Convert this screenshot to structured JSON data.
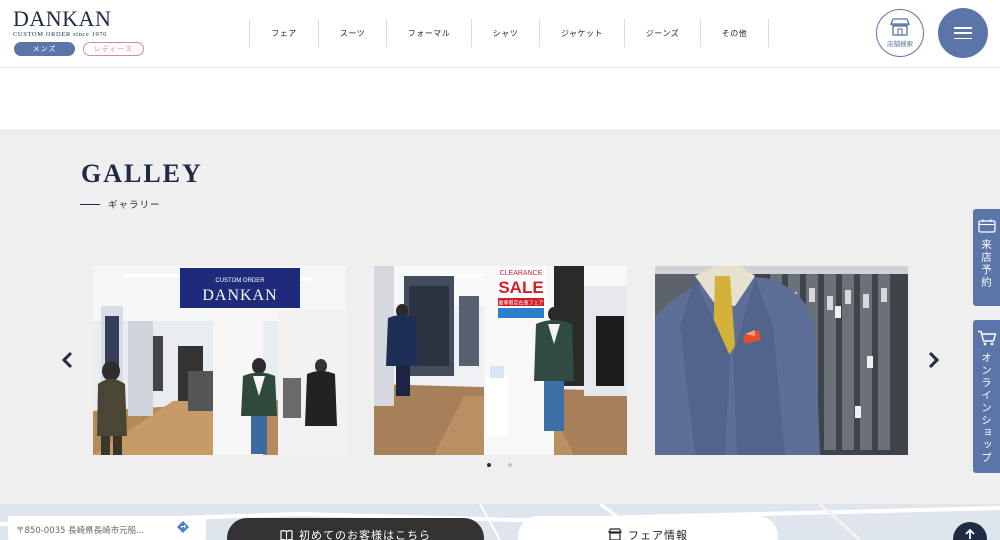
{
  "header": {
    "logo": "DANKAN",
    "logo_sub": "CUSTOM ORDER since 1976",
    "gender_men": "メンズ",
    "gender_women": "レディース",
    "nav": [
      "フェア",
      "スーツ",
      "フォーマル",
      "シャツ",
      "ジャケット",
      "ジーンズ",
      "その他"
    ],
    "store_search": "店舗検索"
  },
  "gallery": {
    "title": "GALLEY",
    "subtitle": "ギャラリー",
    "sign_custom": "CUSTOM ORDER",
    "sign_brand": "DANKAN",
    "sale_top": "CLEARANCE",
    "sale_main": "SALE",
    "sale_bottom": "夏季限定在庫フェア",
    "active_dot": 0,
    "dot_count": 2
  },
  "side": {
    "reserve": "来店予約",
    "online": "オンラインショップ"
  },
  "bottom": {
    "address": "〒850-0035 長崎県長崎市元船...",
    "first_visit": "初めてのお客様はこちら",
    "fair_info": "フェア情報"
  },
  "colors": {
    "brand": "#1f2a44",
    "accent": "#5b75a8",
    "women": "#d98b9a",
    "gallery_bg": "#efefef"
  }
}
